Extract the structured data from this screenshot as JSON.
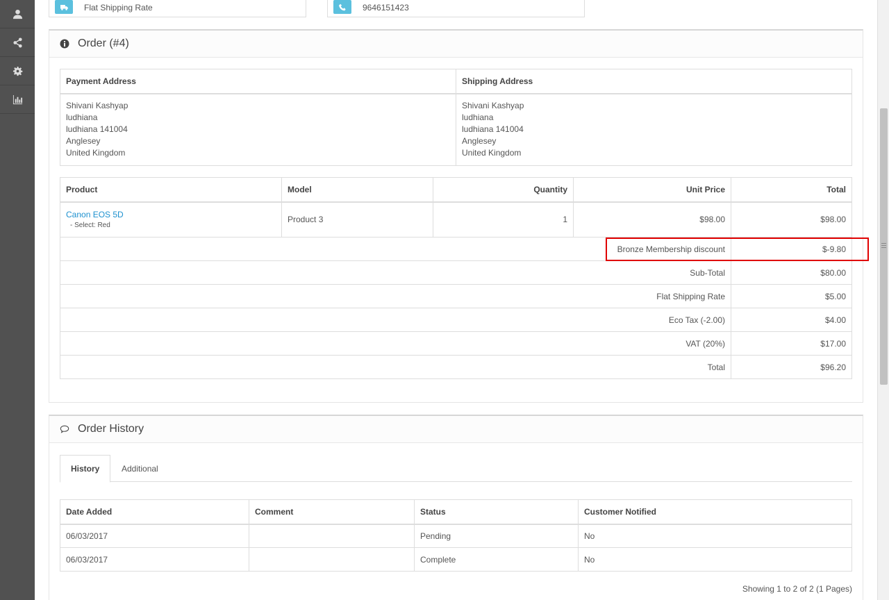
{
  "top_cards": [
    {
      "icon": "truck-icon",
      "text": "Flat Shipping Rate"
    },
    {
      "icon": "phone-icon",
      "text": "9646151423"
    }
  ],
  "order_panel": {
    "title": "Order (#4)",
    "address_headers": {
      "payment": "Payment Address",
      "shipping": "Shipping Address"
    },
    "payment_address": [
      "Shivani Kashyap",
      "ludhiana",
      "ludhiana 141004",
      "Anglesey",
      "United Kingdom"
    ],
    "shipping_address": [
      "Shivani Kashyap",
      "ludhiana",
      "ludhiana 141004",
      "Anglesey",
      "United Kingdom"
    ],
    "product_headers": {
      "product": "Product",
      "model": "Model",
      "quantity": "Quantity",
      "unit_price": "Unit Price",
      "total": "Total"
    },
    "products": [
      {
        "name": "Canon EOS 5D",
        "option": "- Select: Red",
        "model": "Product 3",
        "quantity": "1",
        "unit_price": "$98.00",
        "total": "$98.00"
      }
    ],
    "totals": [
      {
        "label": "Bronze Membership discount",
        "value": "$-9.80"
      },
      {
        "label": "Sub-Total",
        "value": "$80.00"
      },
      {
        "label": "Flat Shipping Rate",
        "value": "$5.00"
      },
      {
        "label": "Eco Tax (-2.00)",
        "value": "$4.00"
      },
      {
        "label": "VAT (20%)",
        "value": "$17.00"
      },
      {
        "label": "Total",
        "value": "$96.20"
      }
    ]
  },
  "history_panel": {
    "title": "Order History",
    "tabs": [
      "History",
      "Additional"
    ],
    "headers": {
      "date": "Date Added",
      "comment": "Comment",
      "status": "Status",
      "notified": "Customer Notified"
    },
    "rows": [
      {
        "date": "06/03/2017",
        "comment": "",
        "status": "Pending",
        "notified": "No"
      },
      {
        "date": "06/03/2017",
        "comment": "",
        "status": "Complete",
        "notified": "No"
      }
    ],
    "pagination": "Showing 1 to 2 of 2 (1 Pages)"
  },
  "colors": {
    "accent": "#1e91cf",
    "info": "#5bc0de",
    "highlight": "#e00000",
    "sidebar": "#515151"
  }
}
